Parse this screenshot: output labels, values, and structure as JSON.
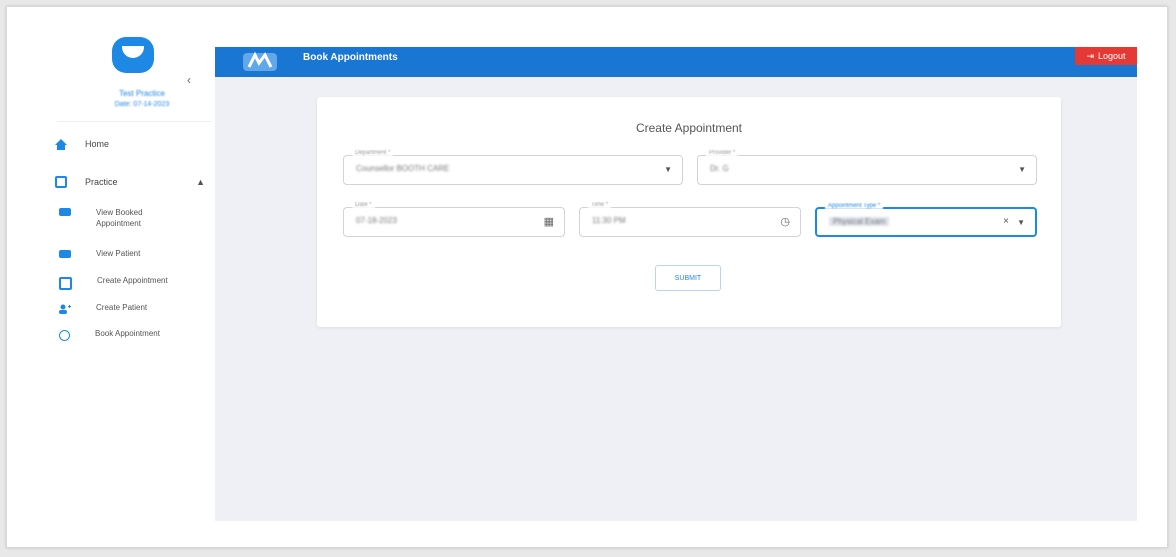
{
  "sidebar": {
    "user_name": "Test Practice",
    "user_date": "Date: 07-14-2023",
    "items": [
      {
        "label": "Home"
      },
      {
        "label": "Practice",
        "expanded": true
      }
    ],
    "sub_items": [
      {
        "label": "View Booked Appointment"
      },
      {
        "label": "View Patient"
      },
      {
        "label": "Create Appointment"
      },
      {
        "label": "Create Patient"
      },
      {
        "label": "Book Appointment"
      }
    ],
    "collapse_glyph": "‹"
  },
  "header": {
    "title": "Book Appointments",
    "logout_label": "Logout"
  },
  "form": {
    "title": "Create Appointment",
    "department": {
      "label": "Department *",
      "value": "Counsellor BOOTH CARE"
    },
    "provider": {
      "label": "Provider *",
      "value": "Dr. G"
    },
    "date": {
      "label": "Date *",
      "value": "07-18-2023"
    },
    "time": {
      "label": "Time *",
      "value": "11:30 PM"
    },
    "appointment_type": {
      "label": "Appointment Type *",
      "value": "Physical Exam"
    },
    "submit_label": "SUBMIT"
  },
  "colors": {
    "primary": "#1976d2",
    "logout": "#e53935",
    "background": "#eef0f5"
  }
}
